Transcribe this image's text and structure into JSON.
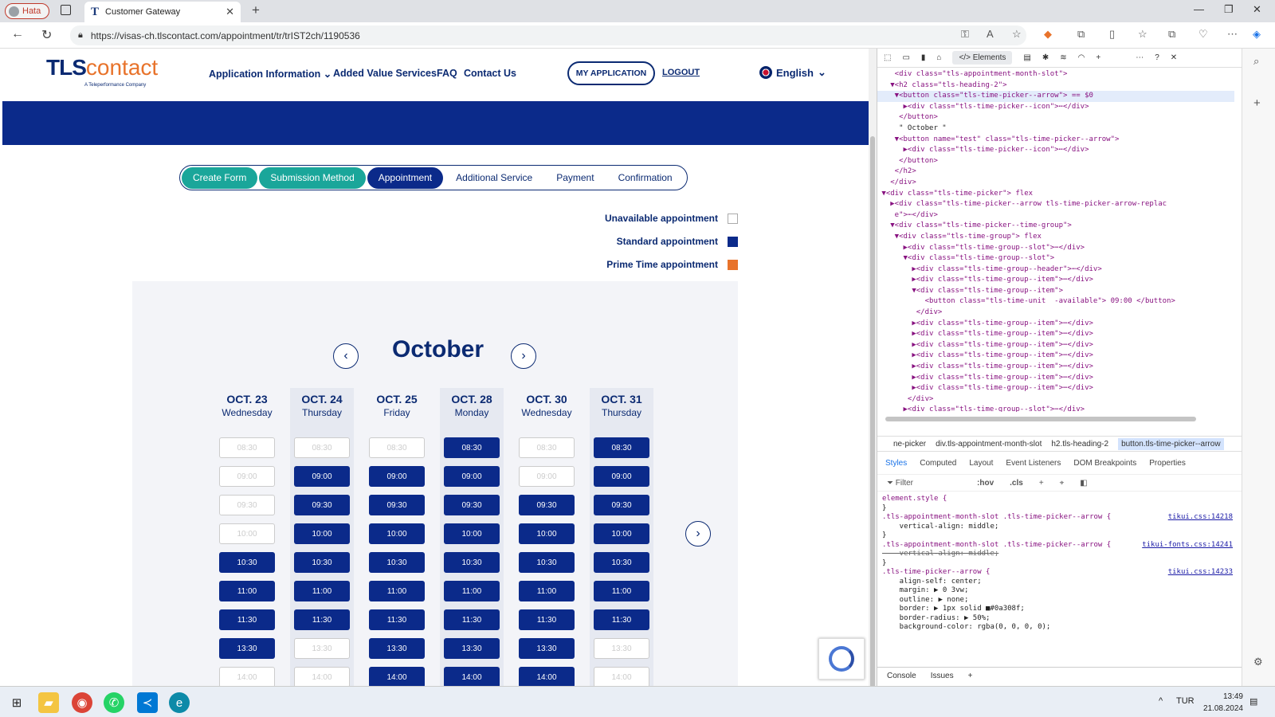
{
  "browser": {
    "profile_label": "Hata",
    "tab_title": "Customer Gateway",
    "url": "https://visas-ch.tlscontact.com/appointment/tr/trIST2ch/1190536"
  },
  "site": {
    "logo_tls": "TLS",
    "logo_contact": "contact",
    "logo_sub": "A Teleperformance Company",
    "nav": [
      "Application Information",
      "Added Value Services",
      "FAQ",
      "Contact Us"
    ],
    "my_application": "MY APPLICATION",
    "logout": "LOGOUT",
    "language": "English"
  },
  "steps": [
    "Create Form",
    "Submission Method",
    "Appointment",
    "Additional Service",
    "Payment",
    "Confirmation"
  ],
  "legend": {
    "unavailable": "Unavailable appointment",
    "standard": "Standard appointment",
    "prime": "Prime Time appointment"
  },
  "colors": {
    "navy": "#0b2a8a",
    "teal": "#1aa69a",
    "orange": "#e8732b"
  },
  "calendar": {
    "month": "October",
    "days": [
      {
        "date": "OCT. 23",
        "weekday": "Wednesday",
        "slots": [
          [
            "08:30",
            false
          ],
          [
            "09:00",
            false
          ],
          [
            "09:30",
            false
          ],
          [
            "10:00",
            false
          ],
          [
            "10:30",
            true
          ],
          [
            "11:00",
            true
          ],
          [
            "11:30",
            true
          ],
          [
            "13:30",
            true
          ],
          [
            "14:00",
            false
          ]
        ]
      },
      {
        "date": "OCT. 24",
        "weekday": "Thursday",
        "slots": [
          [
            "08:30",
            false
          ],
          [
            "09:00",
            true
          ],
          [
            "09:30",
            true
          ],
          [
            "10:00",
            true
          ],
          [
            "10:30",
            true
          ],
          [
            "11:00",
            true
          ],
          [
            "11:30",
            true
          ],
          [
            "13:30",
            false
          ],
          [
            "14:00",
            false
          ]
        ]
      },
      {
        "date": "OCT. 25",
        "weekday": "Friday",
        "slots": [
          [
            "08:30",
            false
          ],
          [
            "09:00",
            true
          ],
          [
            "09:30",
            true
          ],
          [
            "10:00",
            true
          ],
          [
            "10:30",
            true
          ],
          [
            "11:00",
            true
          ],
          [
            "11:30",
            true
          ],
          [
            "13:30",
            true
          ],
          [
            "14:00",
            true
          ]
        ]
      },
      {
        "date": "OCT. 28",
        "weekday": "Monday",
        "slots": [
          [
            "08:30",
            true
          ],
          [
            "09:00",
            true
          ],
          [
            "09:30",
            true
          ],
          [
            "10:00",
            true
          ],
          [
            "10:30",
            true
          ],
          [
            "11:00",
            true
          ],
          [
            "11:30",
            true
          ],
          [
            "13:30",
            true
          ],
          [
            "14:00",
            true
          ]
        ]
      },
      {
        "date": "OCT. 30",
        "weekday": "Wednesday",
        "slots": [
          [
            "08:30",
            false
          ],
          [
            "09:00",
            false
          ],
          [
            "09:30",
            true
          ],
          [
            "10:00",
            true
          ],
          [
            "10:30",
            true
          ],
          [
            "11:00",
            true
          ],
          [
            "11:30",
            true
          ],
          [
            "13:30",
            true
          ],
          [
            "14:00",
            true
          ]
        ]
      },
      {
        "date": "OCT. 31",
        "weekday": "Thursday",
        "slots": [
          [
            "08:30",
            true
          ],
          [
            "09:00",
            true
          ],
          [
            "09:30",
            true
          ],
          [
            "10:00",
            true
          ],
          [
            "10:30",
            true
          ],
          [
            "11:00",
            true
          ],
          [
            "11:30",
            true
          ],
          [
            "13:30",
            false
          ],
          [
            "14:00",
            false
          ]
        ]
      }
    ]
  },
  "devtools": {
    "tab_elements": "Elements",
    "dom_lines": [
      "    <div class=\"tls-appointment-month-slot\">",
      "   ▼<h2 class=\"tls-heading-2\">",
      "    ▼<button class=\"tls-time-picker--arrow\"> == $0",
      "      ▶<div class=\"tls-time-picker--icon\">⋯</div>",
      "     </button>",
      "     \" October \"",
      "    ▼<button name=\"test\" class=\"tls-time-picker--arrow\">",
      "      ▶<div class=\"tls-time-picker--icon\">⋯</div>",
      "     </button>",
      "    </h2>",
      "   </div>",
      " ▼<div class=\"tls-time-picker\"> flex",
      "   ▶<div class=\"tls-time-picker--arrow tls-time-picker-arrow-replac",
      "    e\">⋯</div>",
      "   ▼<div class=\"tls-time-picker--time-group\">",
      "    ▼<div class=\"tls-time-group\"> flex",
      "      ▶<div class=\"tls-time-group--slot\">⋯</div>",
      "      ▼<div class=\"tls-time-group--slot\">",
      "        ▶<div class=\"tls-time-group--header\">⋯</div>",
      "        ▶<div class=\"tls-time-group--item\">⋯</div>",
      "        ▼<div class=\"tls-time-group--item\">",
      "           <button class=\"tls-time-unit  -available\"> 09:00 </button>",
      "         </div>",
      "        ▶<div class=\"tls-time-group--item\">⋯</div>",
      "        ▶<div class=\"tls-time-group--item\">⋯</div>",
      "        ▶<div class=\"tls-time-group--item\">⋯</div>",
      "        ▶<div class=\"tls-time-group--item\">⋯</div>",
      "        ▶<div class=\"tls-time-group--item\">⋯</div>",
      "        ▶<div class=\"tls-time-group--item\">⋯</div>",
      "        ▶<div class=\"tls-time-group--item\">⋯</div>",
      "       </div>",
      "      ▶<div class=\"tls-time-group--slot\">⋯</div>",
      "      ▶<div class=\"tls-time-group--slot\">⋯</div>"
    ],
    "crumbs": [
      "ne-picker",
      "div.tls-appointment-month-slot",
      "h2.tls-heading-2",
      "button.tls-time-picker--arrow"
    ],
    "style_tabs": [
      "Styles",
      "Computed",
      "Layout",
      "Event Listeners",
      "DOM Breakpoints",
      "Properties"
    ],
    "filter_placeholder": "Filter",
    "hov": ":hov",
    "cls": ".cls",
    "styles": [
      {
        "t": "element.style {",
        "link": ""
      },
      {
        "t": "}",
        "link": ""
      },
      {
        "t": ".tls-appointment-month-slot .tls-time-picker--arrow {",
        "link": "tikui.css:14218"
      },
      {
        "t": "    vertical-align: middle;",
        "link": ""
      },
      {
        "t": "}",
        "link": ""
      },
      {
        "t": ".tls-appointment-month-slot .tls-time-picker--arrow {",
        "link": "tikui-fonts.css:14241"
      },
      {
        "t": "    vertical-align: middle;",
        "link": "",
        "strike": true
      },
      {
        "t": "}",
        "link": ""
      },
      {
        "t": ".tls-time-picker--arrow {",
        "link": "tikui.css:14233"
      },
      {
        "t": "    align-self: center;",
        "link": ""
      },
      {
        "t": "    margin: ▶ 0 3vw;",
        "link": ""
      },
      {
        "t": "    outline: ▶ none;",
        "link": ""
      },
      {
        "t": "    border: ▶ 1px solid ■#0a308f;",
        "link": ""
      },
      {
        "t": "    border-radius: ▶ 50%;",
        "link": ""
      },
      {
        "t": "    background-color: rgba(0, 0, 0, 0);",
        "link": ""
      }
    ],
    "console_tabs": [
      "Console",
      "Issues"
    ]
  },
  "taskbar": {
    "lang": "TUR",
    "time": "13:49",
    "date": "21.08.2024"
  }
}
